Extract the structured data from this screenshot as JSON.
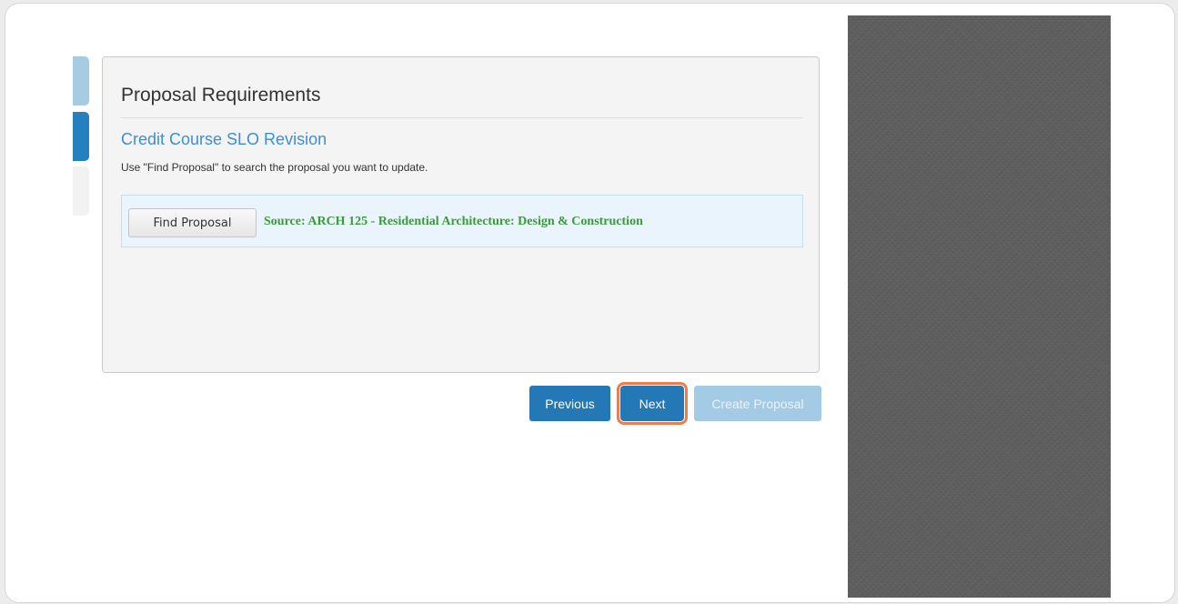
{
  "panel": {
    "title": "Proposal Requirements",
    "proposal_type": "Credit Course SLO Revision",
    "help_text": "Use \"Find Proposal\" to search the proposal you want to update.",
    "find_button_label": "Find Proposal",
    "source_text": "Source:  ARCH 125 - Residential Architecture: Design & Construction"
  },
  "buttons": {
    "previous_label": "Previous",
    "next_label": "Next",
    "create_label": "Create Proposal"
  },
  "colors": {
    "accent": "#2478b5",
    "highlight": "#f07b4b",
    "source_green": "#3c9a3c",
    "disabled": "#a4cbe6"
  }
}
